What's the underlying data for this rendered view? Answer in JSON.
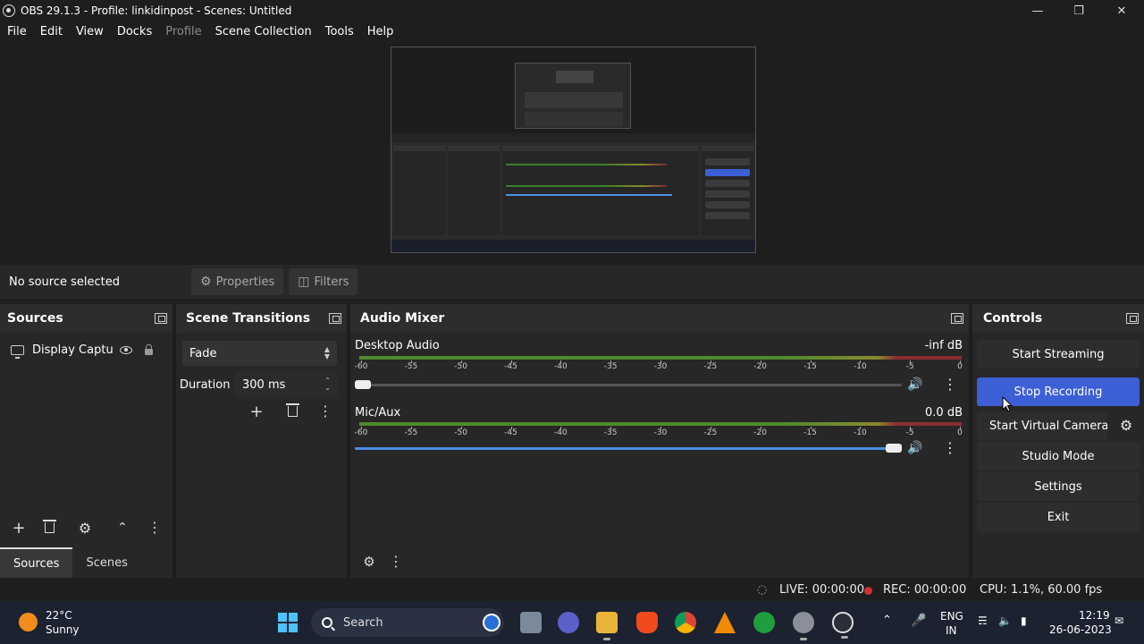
{
  "titlebar": {
    "title": "OBS 29.1.3 - Profile: linkidinpost - Scenes: Untitled"
  },
  "menu": [
    {
      "label": "File",
      "disabled": false
    },
    {
      "label": "Edit",
      "disabled": false
    },
    {
      "label": "View",
      "disabled": false
    },
    {
      "label": "Docks",
      "disabled": false
    },
    {
      "label": "Profile",
      "disabled": true
    },
    {
      "label": "Scene Collection",
      "disabled": false
    },
    {
      "label": "Tools",
      "disabled": false
    },
    {
      "label": "Help",
      "disabled": false
    }
  ],
  "sourcebar": {
    "no_source": "No source selected",
    "properties_label": "Properties",
    "filters_label": "Filters"
  },
  "sources": {
    "title": "Sources",
    "items": [
      {
        "label": "Display Captur"
      }
    ],
    "tabs": {
      "sources": "Sources",
      "scenes": "Scenes"
    }
  },
  "transitions": {
    "title": "Scene Transitions",
    "transition": "Fade",
    "duration_label": "Duration",
    "duration_value": "300 ms"
  },
  "mixer": {
    "title": "Audio Mixer",
    "ticks": [
      "-60",
      "-55",
      "-50",
      "-45",
      "-40",
      "-35",
      "-30",
      "-25",
      "-20",
      "-15",
      "-10",
      "-5",
      "0"
    ],
    "channels": [
      {
        "name": "Desktop Audio",
        "db": "-inf dB",
        "volume": 0.0
      },
      {
        "name": "Mic/Aux",
        "db": "0.0 dB",
        "volume": 1.0
      }
    ]
  },
  "controls": {
    "title": "Controls",
    "start_streaming": "Start Streaming",
    "stop_recording": "Stop Recording",
    "start_virtual_camera": "Start Virtual Camera",
    "studio_mode": "Studio Mode",
    "settings": "Settings",
    "exit": "Exit"
  },
  "status": {
    "live": "LIVE: 00:00:00",
    "rec": "REC: 00:00:00",
    "cpu": "CPU: 1.1%, 60.00 fps"
  },
  "taskbar": {
    "temperature": "22°C",
    "weather": "Sunny",
    "search_placeholder": "Search",
    "lang_line1": "ENG",
    "lang_line2": "IN",
    "time": "12:19",
    "date": "26-06-2023"
  },
  "colors": {
    "accent": "#3d5fd6",
    "volume_fill": "#4c8ee8",
    "rec_dot": "#d03030"
  }
}
